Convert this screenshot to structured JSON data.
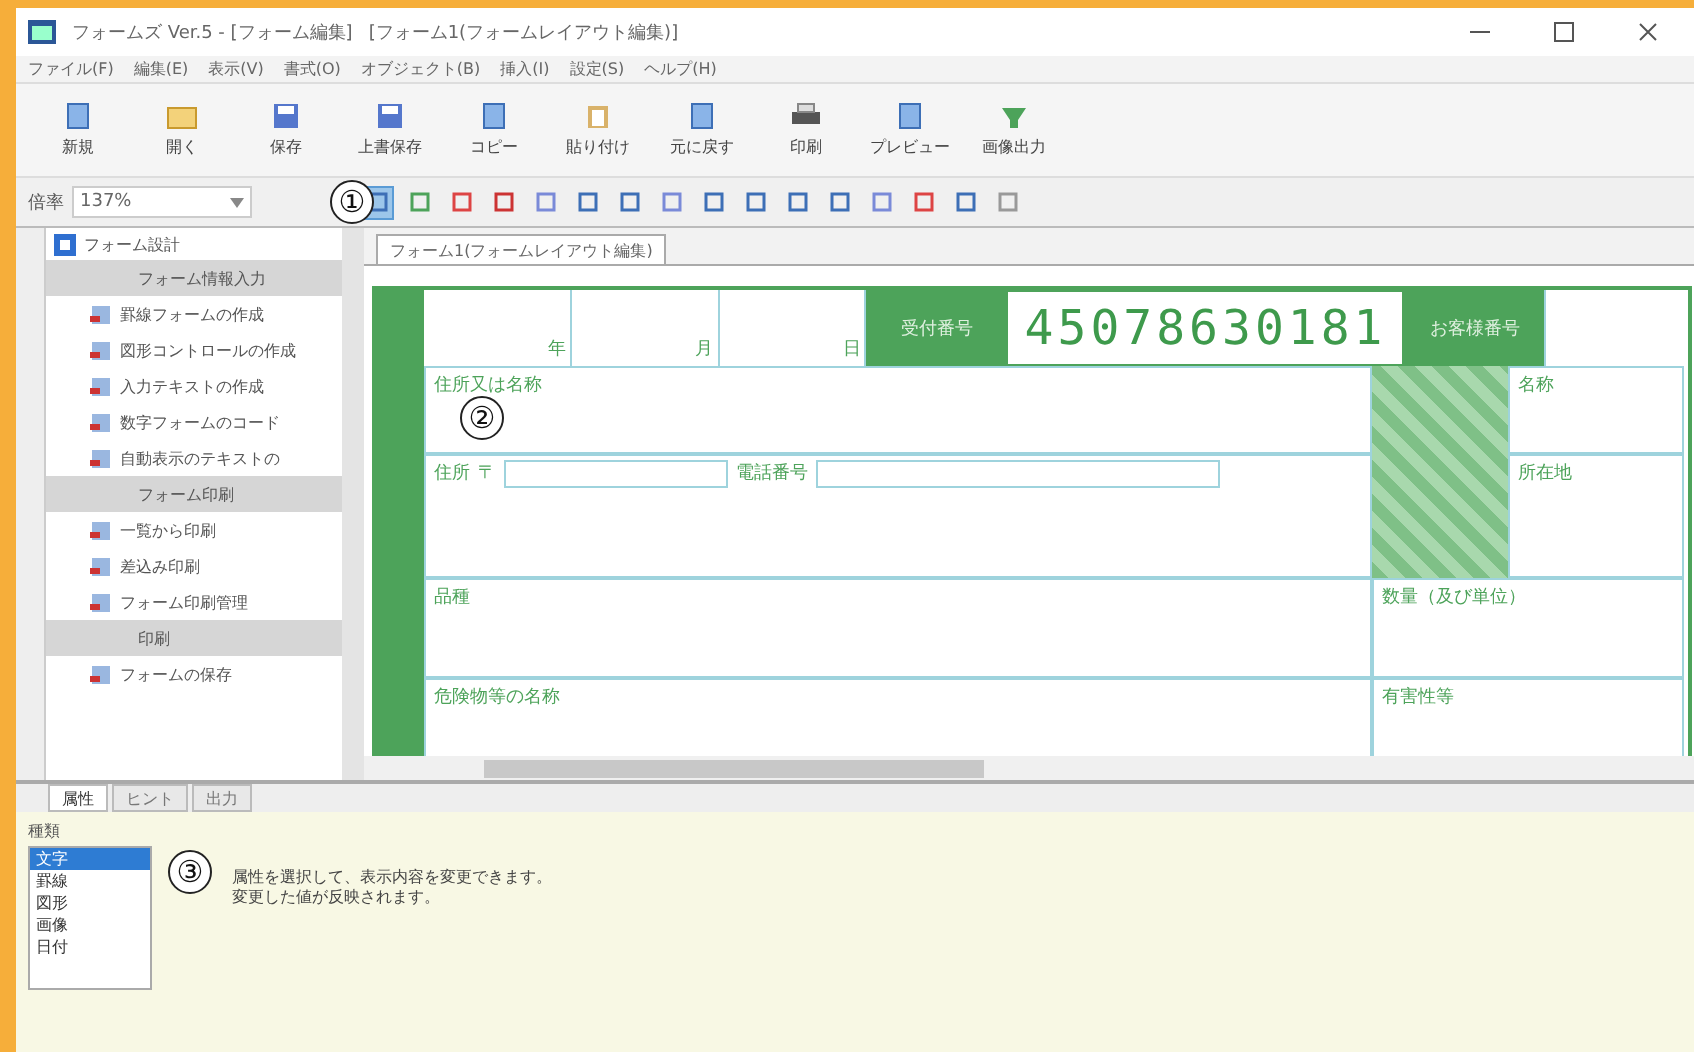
{
  "window": {
    "title": "フォームズ Ver.5 - [フォーム編集]",
    "document": "[フォーム1(フォームレイアウト編集)]"
  },
  "menu": [
    "ファイル(F)",
    "編集(E)",
    "表示(V)",
    "書式(O)",
    "オブジェクト(B)",
    "挿入(I)",
    "設定(S)",
    "ヘルプ(H)"
  ],
  "toolbar": [
    {
      "label": "新規",
      "kind": "doc"
    },
    {
      "label": "開く",
      "kind": "folder"
    },
    {
      "label": "保存",
      "kind": "disk"
    },
    {
      "label": "上書保存",
      "kind": "disk"
    },
    {
      "label": "コピー",
      "kind": "doc"
    },
    {
      "label": "貼り付け",
      "kind": "clip"
    },
    {
      "label": "元に戻す",
      "kind": "doc"
    },
    {
      "label": "印刷",
      "kind": "printer"
    },
    {
      "label": "プレビュー",
      "kind": "doc"
    },
    {
      "label": "画像出力",
      "kind": "green"
    }
  ],
  "zoom": {
    "label": "倍率",
    "value": "137%"
  },
  "tools": [
    {
      "selected": true
    },
    {
      "selected": false
    },
    {
      "selected": false
    },
    {
      "selected": false
    },
    {
      "selected": false
    },
    {
      "selected": false
    },
    {
      "selected": false
    },
    {
      "selected": false
    },
    {
      "selected": false
    },
    {
      "selected": false
    },
    {
      "selected": false
    },
    {
      "selected": false
    },
    {
      "selected": false
    },
    {
      "selected": false
    },
    {
      "selected": false
    },
    {
      "selected": false
    }
  ],
  "sidebar": {
    "title": "フォーム設計",
    "items": [
      {
        "label": "フォーム情報入力",
        "kind": "section"
      },
      {
        "label": "罫線フォームの作成",
        "kind": "item"
      },
      {
        "label": "図形コントロールの作成",
        "kind": "item"
      },
      {
        "label": "入力テキストの作成",
        "kind": "item"
      },
      {
        "label": "数字フォームのコード",
        "kind": "item"
      },
      {
        "label": "自動表示のテキストの",
        "kind": "item"
      },
      {
        "label": "フォーム印刷",
        "kind": "section"
      },
      {
        "label": "一覧から印刷",
        "kind": "item"
      },
      {
        "label": "差込み印刷",
        "kind": "item"
      },
      {
        "label": "フォーム印刷管理",
        "kind": "item"
      },
      {
        "label": "印刷",
        "kind": "section"
      },
      {
        "label": "フォームの保存",
        "kind": "item"
      }
    ]
  },
  "tab": {
    "label": "フォーム1(フォームレイアウト編集)",
    "selected": true
  },
  "form": {
    "date_labels": [
      "年",
      "月",
      "日"
    ],
    "receipt_label": "受付番号",
    "receipt_number": "45078630181",
    "customer_label": "お客様番号",
    "name_label": "住所又は名称",
    "address_label": "住所",
    "postal_mark": "〒",
    "phone_label": "電話番号",
    "side_name_label": "名称",
    "side_address_label": "所在地",
    "goods_label": "品種",
    "quantity_label": "数量（及び単位）",
    "hazard_label": "危険物等の名称",
    "harm_label": "有害性等"
  },
  "callouts": [
    "①",
    "②",
    "③"
  ],
  "bottom": {
    "tabs": [
      {
        "label": "属性",
        "selected": true
      },
      {
        "label": "ヒント",
        "selected": false
      },
      {
        "label": "出力",
        "selected": false
      }
    ],
    "list_title": "種類",
    "list": [
      {
        "label": "文字",
        "selected": true
      },
      {
        "label": "罫線",
        "selected": false
      },
      {
        "label": "図形",
        "selected": false
      },
      {
        "label": "画像",
        "selected": false
      },
      {
        "label": "日付",
        "selected": false
      }
    ],
    "message": [
      "属性を選択して、表示内容を変更できます。",
      "変更した値が反映されます。"
    ]
  }
}
